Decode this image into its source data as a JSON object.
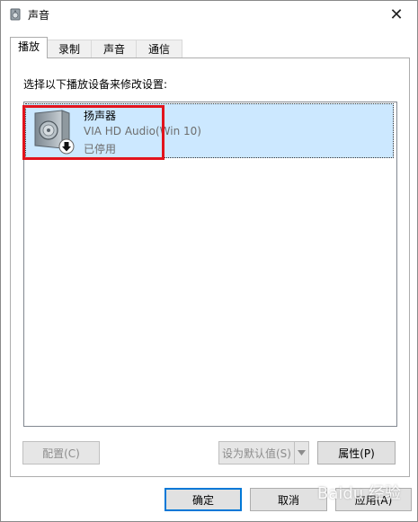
{
  "window": {
    "title": "声音",
    "close_glyph": "✕"
  },
  "tabs": [
    {
      "label": "播放",
      "active": true
    },
    {
      "label": "录制",
      "active": false
    },
    {
      "label": "声音",
      "active": false
    },
    {
      "label": "通信",
      "active": false
    }
  ],
  "panel": {
    "instruction": "选择以下播放设备来修改设置:"
  },
  "devices": [
    {
      "name": "扬声器",
      "driver": "VIA HD Audio(Win 10)",
      "status": "已停用",
      "icon": "speaker-icon",
      "state_icon": "disabled-arrow-icon"
    }
  ],
  "buttons": {
    "configure": "配置(C)",
    "set_default": "设为默认值(S)",
    "properties": "属性(P)",
    "ok": "确定",
    "cancel": "取消",
    "apply": "应用(A)"
  },
  "watermark": "Baidu 经验",
  "colors": {
    "selection": "#cce8ff",
    "highlight_border": "#e2141d",
    "default_button_border": "#0078d7"
  }
}
